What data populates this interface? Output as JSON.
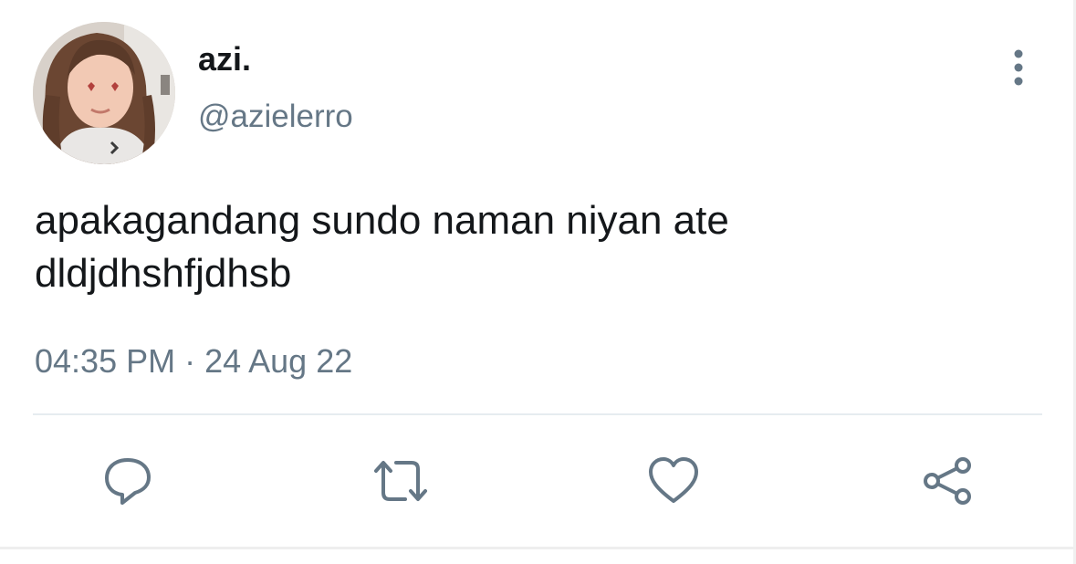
{
  "tweet": {
    "display_name": "azi.",
    "handle": "@azielerro",
    "text_lines": [
      "apakagandang sundo naman niyan ate",
      "dldjdhshfjdhsb"
    ],
    "time": "04:35 PM",
    "separator": "·",
    "date": "24 Aug 22"
  },
  "icons": {
    "more": "more-vertical-icon",
    "reply": "reply-icon",
    "retweet": "retweet-icon",
    "like": "heart-icon",
    "share": "share-icon"
  },
  "colors": {
    "text_primary": "#14171a",
    "text_secondary": "#657786",
    "icon": "#657786",
    "divider": "#e6ecf0"
  }
}
